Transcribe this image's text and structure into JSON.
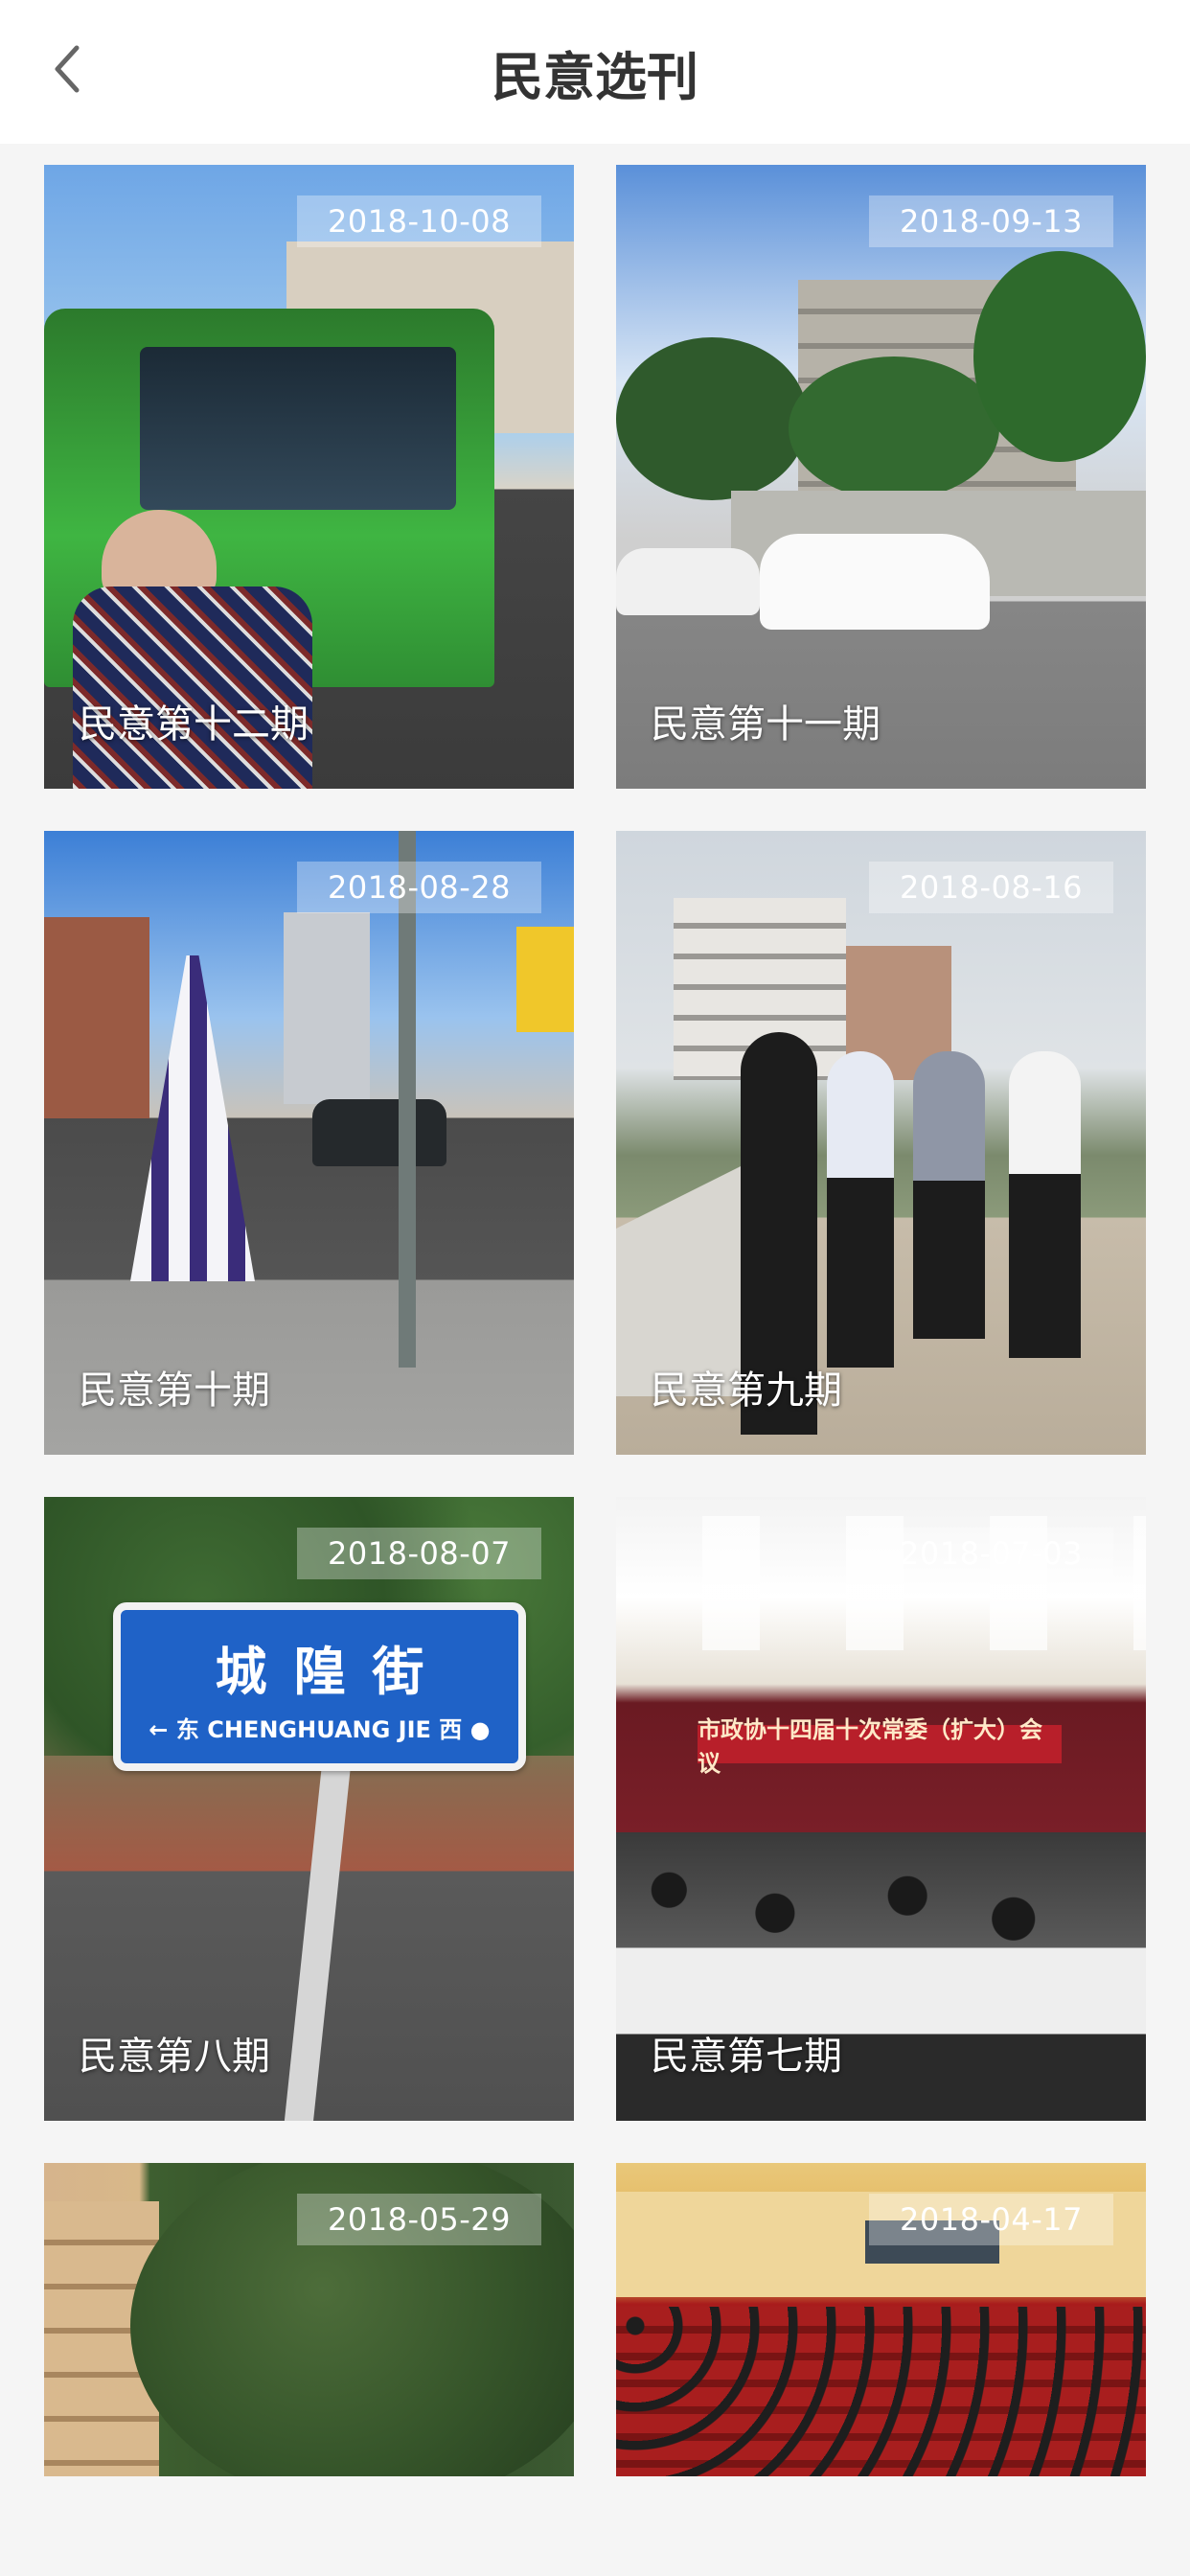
{
  "header": {
    "title": "民意选刊",
    "back_icon": "chevron-left-icon"
  },
  "colors": {
    "background": "#f5f5f5",
    "title": "#333333",
    "badge_bg": "rgba(255,255,255,0.32)",
    "label_text": "#ffffff"
  },
  "issues": [
    {
      "date": "2018-10-08",
      "title": "民意第十二期"
    },
    {
      "date": "2018-09-13",
      "title": "民意第十一期"
    },
    {
      "date": "2018-08-28",
      "title": "民意第十期"
    },
    {
      "date": "2018-08-16",
      "title": "民意第九期"
    },
    {
      "date": "2018-08-07",
      "title": "民意第八期"
    },
    {
      "date": "2018-07-03",
      "title": "民意第七期"
    },
    {
      "date": "2018-05-29",
      "title": ""
    },
    {
      "date": "2018-04-17",
      "title": ""
    }
  ],
  "sign": {
    "chinese": "城隍街",
    "romanized": "← 东 CHENGHUANG JIE 西 ●"
  },
  "meeting_banner": "市政协十四届十次常委（扩大）会议"
}
